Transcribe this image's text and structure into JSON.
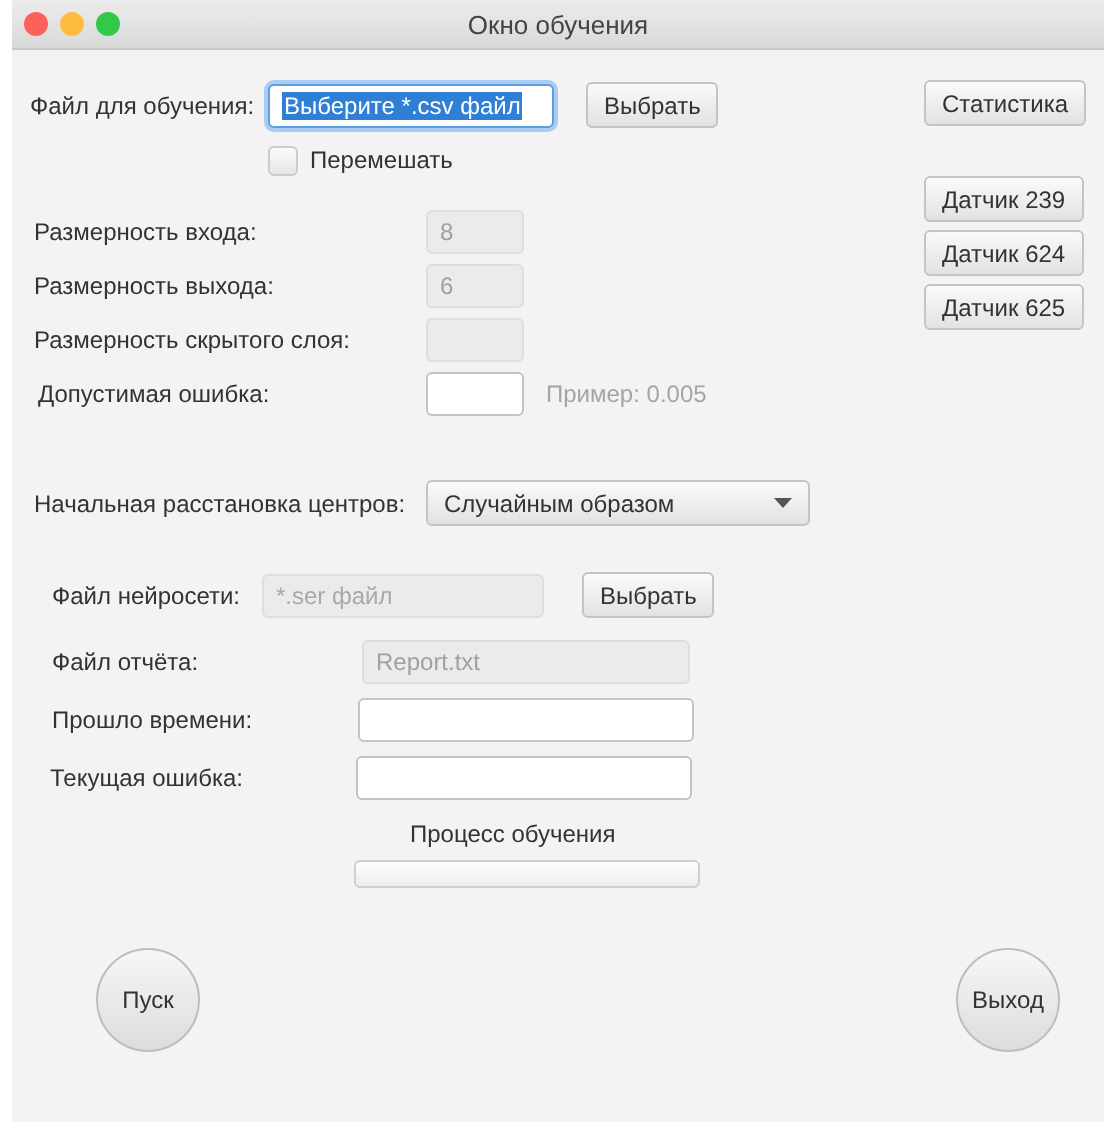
{
  "window": {
    "title": "Окно обучения"
  },
  "training_file": {
    "label": "Файл для обучения:",
    "value": "Выберите *.csv файл",
    "button": "Выбрать"
  },
  "shuffle": {
    "label": "Перемешать",
    "checked": false
  },
  "side_buttons": {
    "statistics": "Статистика",
    "sensors": [
      "Датчик 239",
      "Датчик 624",
      "Датчик 625"
    ]
  },
  "params": [
    {
      "label": "Размерность входа:",
      "value": "8",
      "disabled": true
    },
    {
      "label": "Размерность выхода:",
      "value": "6",
      "disabled": true
    },
    {
      "label": "Размерность скрытого слоя:",
      "disabled": true
    },
    {
      "label": "Допустимая ошибка:",
      "disabled": false,
      "hint": "Пример: 0.005"
    }
  ],
  "centers": {
    "label": "Начальная расстановка центров:",
    "value": "Случайным образом"
  },
  "network_file": {
    "label": "Файл нейросети:",
    "placeholder": "*.ser файл",
    "button": "Выбрать",
    "disabled": true
  },
  "outputs": [
    {
      "label": "Файл отчёта:",
      "value": "Report.txt",
      "disabled": true
    },
    {
      "label": "Прошло времени:",
      "disabled": false
    },
    {
      "label": "Текущая ошибка:",
      "disabled": false
    }
  ],
  "progress": {
    "label": "Процесс обучения",
    "level": 0
  },
  "buttons": {
    "start": "Пуск",
    "exit": "Выход"
  }
}
